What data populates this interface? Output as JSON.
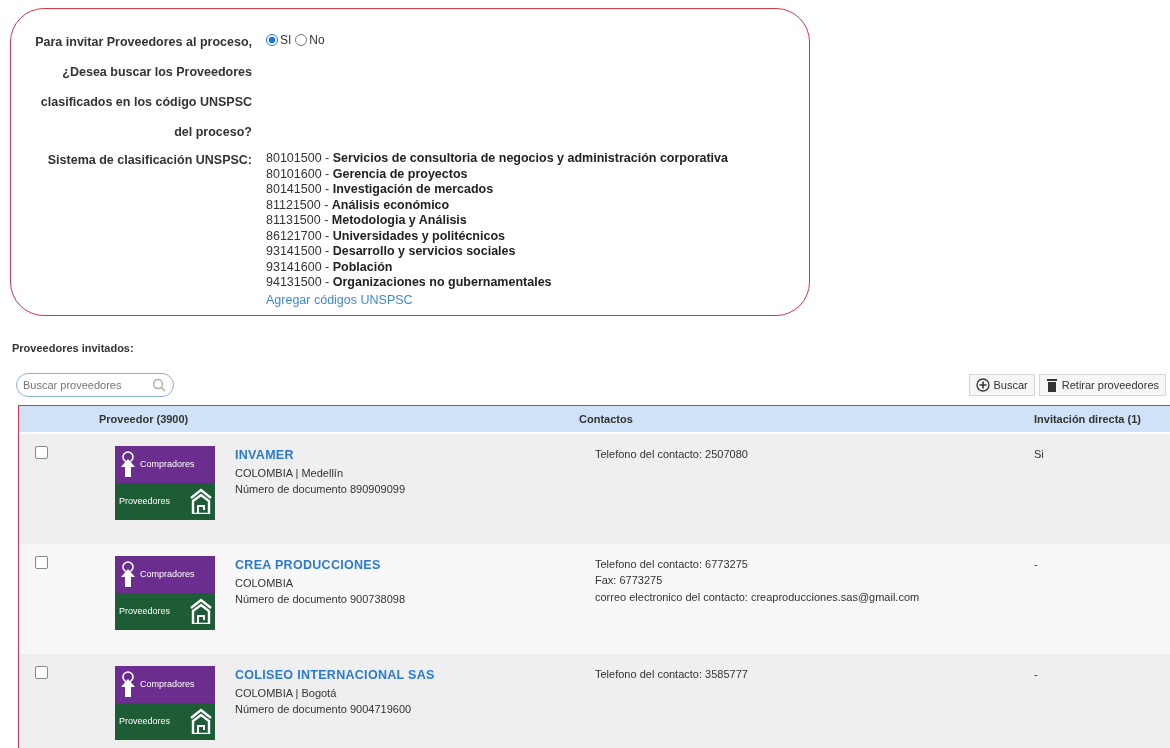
{
  "question": {
    "label": "Para invitar Proveedores al proceso, ¿Desea buscar los Proveedores clasificados en los código UNSPSC del proceso?",
    "options": [
      {
        "label": "SI",
        "selected": true
      },
      {
        "label": "No",
        "selected": false
      }
    ]
  },
  "unspsc": {
    "label": "Sistema de clasificación UNSPSC:",
    "codes": [
      "80101500 - **Servicios de consultoria de negocios y administración corporativa**",
      "80101600 - **Gerencia de proyectos**",
      "80141500 - **Investigación de mercados**",
      "81121500 - **Análisis económico**",
      "81131500 - **Metodologia y Análisis**",
      "86121700 - **Universidades y politécnicos**",
      "93141500 - **Desarrollo y servicios sociales**",
      "93141600 - **Población**",
      "94131500 - **Organizaciones no gubernamentales**"
    ],
    "add_link": "Agregar códigos UNSPSC"
  },
  "invited": {
    "title": "Proveedores invitados:",
    "search": {
      "placeholder": "Buscar proveedores"
    },
    "buttons": [
      "Buscar",
      "Retirar proveedores"
    ]
  },
  "table": {
    "columns": [
      "Proveedor (3900)",
      "Contactos",
      "Invitación directa (1)"
    ],
    "rows": [
      {
        "checked": false,
        "logo_top": "Compradores",
        "logo_bottom": "Proveedores",
        "name": "INVAMER",
        "location": "COLOMBIA | Medellín",
        "document": "Número de documento 890909099",
        "contacts": [
          "Telefono del contacto: 2507080"
        ],
        "invitation": "Si"
      },
      {
        "checked": false,
        "logo_top": "Compradores",
        "logo_bottom": "Proveedores",
        "name": "CREA PRODUCCIONES",
        "location": "COLOMBIA",
        "document": "Número de documento 900738098",
        "contacts": [
          "Telefono del contacto: 6773275",
          "Fax: 6773275",
          "correo electronico del contacto: creaproducciones.sas@gmail.com"
        ],
        "invitation": "-"
      },
      {
        "checked": false,
        "logo_top": "Compradores",
        "logo_bottom": "Proveedores",
        "name": "COLISEO INTERNACIONAL SAS",
        "location": "COLOMBIA | Bogotá",
        "document": "Número de documento 9004719600",
        "contacts": [
          "Telefono del contacto: 3585777"
        ],
        "invitation": "-"
      }
    ]
  }
}
